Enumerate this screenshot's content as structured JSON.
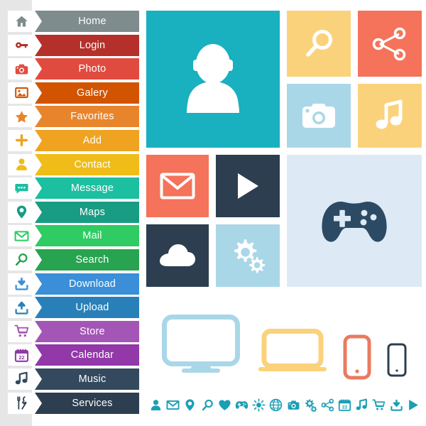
{
  "theme": {
    "page_background": "#ffffff",
    "left_backdrop": "#e6e6e6",
    "nav_text_color": "#ffffff",
    "strip_icon_color": "#1b9fb5"
  },
  "sidebar": {
    "items": [
      {
        "label": "Home",
        "icon": "home-icon",
        "color": "#7f8c8d"
      },
      {
        "label": "Login",
        "icon": "key-icon",
        "color": "#b5302a"
      },
      {
        "label": "Photo",
        "icon": "camera-icon",
        "color": "#e14b3f"
      },
      {
        "label": "Galery",
        "icon": "image-icon",
        "color": "#d35400"
      },
      {
        "label": "Favorites",
        "icon": "star-icon",
        "color": "#e8852c"
      },
      {
        "label": "Add",
        "icon": "plus-icon",
        "color": "#f0a320"
      },
      {
        "label": "Contact",
        "icon": "person-icon",
        "color": "#efbc18"
      },
      {
        "label": "Message",
        "icon": "chat-icon",
        "color": "#1cbfa0"
      },
      {
        "label": "Maps",
        "icon": "map-pin-icon",
        "color": "#189c83"
      },
      {
        "label": "Mail",
        "icon": "envelope-icon",
        "color": "#2ecc62"
      },
      {
        "label": "Search",
        "icon": "magnifier-icon",
        "color": "#28a350"
      },
      {
        "label": "Download",
        "icon": "download-icon",
        "color": "#3a8fd8"
      },
      {
        "label": "Upload",
        "icon": "upload-icon",
        "color": "#2980b9"
      },
      {
        "label": "Store",
        "icon": "cart-icon",
        "color": "#a356b5"
      },
      {
        "label": "Calendar",
        "icon": "calendar-icon",
        "color": "#9238a8",
        "day": "22"
      },
      {
        "label": "Music",
        "icon": "music-icon",
        "color": "#34495e"
      },
      {
        "label": "Services",
        "icon": "tools-icon",
        "color": "#2c3e50"
      }
    ]
  },
  "tiles": [
    {
      "name": "profile-tile",
      "icon": "person-icon",
      "background": "#19b0bf",
      "icon_color": "#ffffff"
    },
    {
      "name": "search-tile",
      "icon": "magnifier-icon",
      "background": "#fbd27c",
      "icon_color": "#ffffff"
    },
    {
      "name": "share-tile",
      "icon": "share-icon",
      "background": "#f4735a",
      "icon_color": "#ffffff"
    },
    {
      "name": "camera-tile",
      "icon": "camera-icon",
      "background": "#a9d7e8",
      "icon_color": "#ffffff"
    },
    {
      "name": "music-tile",
      "icon": "music-icon",
      "background": "#fbd27c",
      "icon_color": "#ffffff"
    },
    {
      "name": "mail-tile",
      "icon": "envelope-icon",
      "background": "#f4735a",
      "icon_color": "#ffffff"
    },
    {
      "name": "play-tile",
      "icon": "play-icon",
      "background": "#2c3e50",
      "icon_color": "#ffffff"
    },
    {
      "name": "cloud-tile",
      "icon": "cloud-icon",
      "background": "#2c3e50",
      "icon_color": "#ffffff"
    },
    {
      "name": "settings-tile",
      "icon": "gears-icon",
      "background": "#a9d7e8",
      "icon_color": "#ffffff"
    },
    {
      "name": "game-tile",
      "icon": "gamepad-icon",
      "background": "#ddeaf6",
      "icon_color": "#2c4a63"
    }
  ],
  "devices": [
    {
      "name": "desktop-monitor-outline",
      "color": "#a9d7e8"
    },
    {
      "name": "laptop-outline",
      "color": "#fbd27c"
    },
    {
      "name": "phone-outline",
      "color": "#ea7a5f"
    },
    {
      "name": "small-phone-outline",
      "color": "#2c3e50"
    }
  ],
  "icon_strip": {
    "color": "#1b9fb5",
    "icons": [
      "person-icon",
      "envelope-icon",
      "map-pin-icon",
      "magnifier-icon",
      "heart-icon",
      "gamepad-icon",
      "brightness-icon",
      "globe-icon",
      "camera-icon",
      "gears-icon",
      "share-icon",
      "calendar-icon",
      "music-icon",
      "cart-icon",
      "download-icon",
      "play-icon"
    ],
    "calendar_day": "22"
  }
}
